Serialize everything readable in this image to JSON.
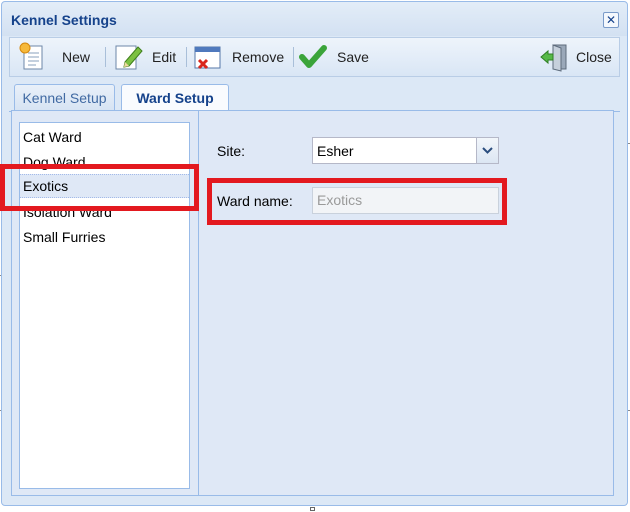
{
  "window": {
    "title": "Kennel Settings"
  },
  "toolbar": {
    "new_label": "New",
    "edit_label": "Edit",
    "remove_label": "Remove",
    "save_label": "Save",
    "close_label": "Close"
  },
  "tabs": [
    {
      "label": "Kennel Setup",
      "active": false
    },
    {
      "label": "Ward Setup",
      "active": true
    }
  ],
  "wards": [
    {
      "label": "Cat Ward"
    },
    {
      "label": "Dog Ward"
    },
    {
      "label": "Exotics",
      "selected": true
    },
    {
      "label": "Isolation Ward"
    },
    {
      "label": "Small Furries"
    }
  ],
  "form": {
    "site_label": "Site:",
    "site_value": "Esher",
    "ward_name_label": "Ward name:",
    "ward_name_value": "Exotics"
  },
  "colors": {
    "highlight": "#e3191f",
    "title_text": "#15428b",
    "panel_bg": "#dfe8f6"
  },
  "icons": [
    "new-document-icon",
    "edit-pencil-icon",
    "remove-icon",
    "save-check-icon",
    "close-door-icon",
    "close-x-icon",
    "chevron-down-icon"
  ]
}
